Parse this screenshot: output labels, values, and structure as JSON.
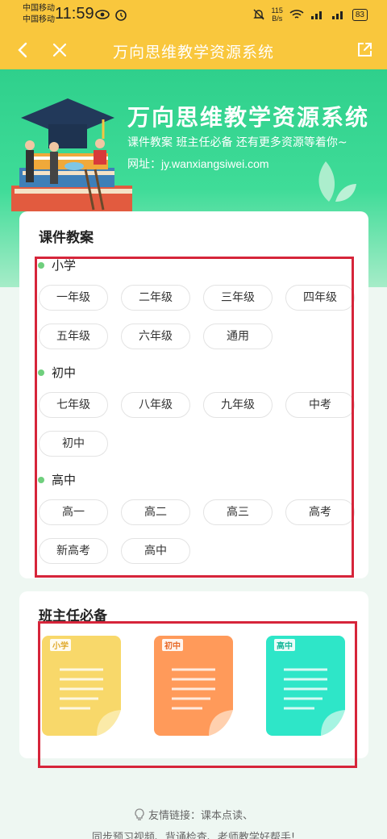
{
  "status_bar": {
    "carrier1": "中国移动",
    "carrier2": "中国移动",
    "time": "11:59",
    "speed": "115",
    "speed_unit": "B/s",
    "battery": "83"
  },
  "header": {
    "title": "万向思维教学资源系统",
    "back_icon": "chevron-left-icon",
    "close_icon": "close-icon",
    "share_icon": "share-icon"
  },
  "banner": {
    "title": "万向思维教学资源系统",
    "subtitle": "课件教案  班主任必备  还有更多资源等着你~",
    "url_label": "网址：",
    "url": "jy.wanxiangsiwei.com"
  },
  "lessons": {
    "title": "课件教案",
    "sections": [
      {
        "label": "小学",
        "items": [
          "一年级",
          "二年级",
          "三年级",
          "四年级",
          "五年级",
          "六年级",
          "通用"
        ]
      },
      {
        "label": "初中",
        "items": [
          "七年级",
          "八年级",
          "九年级",
          "中考",
          "初中"
        ]
      },
      {
        "label": "高中",
        "items": [
          "高一",
          "高二",
          "高三",
          "高考",
          "新高考",
          "高中"
        ]
      }
    ]
  },
  "teacher": {
    "title": "班主任必备",
    "docs": [
      {
        "tag": "小学",
        "color": "#f8d86a"
      },
      {
        "tag": "初中",
        "color": "#ff9a5a"
      },
      {
        "tag": "高中",
        "color": "#2ee6c8"
      }
    ]
  },
  "footer": {
    "line1": "友情链接：课本点读、",
    "line2": "同步预习视频、背诵检查、老师教学好帮手!"
  },
  "colors": {
    "accent": "#f9c73d",
    "banner": "#2fd08c",
    "highlight": "#d6253a"
  }
}
